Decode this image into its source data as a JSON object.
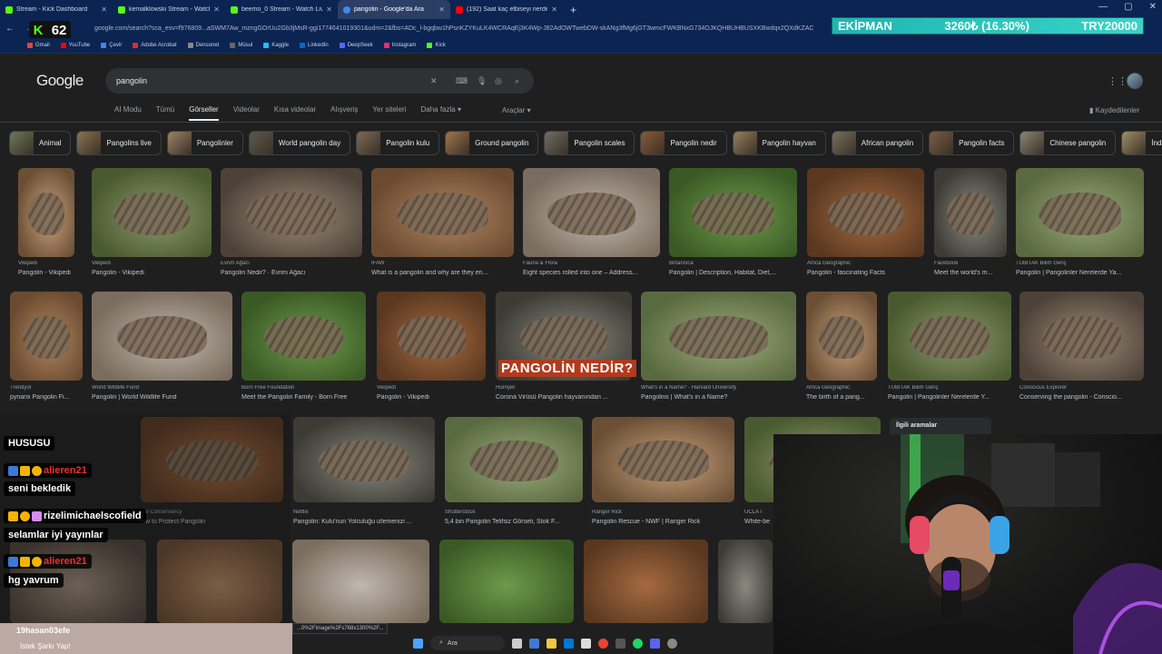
{
  "browser": {
    "tabs": [
      {
        "title": "Stream - Kick Dashboard",
        "color": "#53fc18"
      },
      {
        "title": "kemalklowski Stream - Watch Live",
        "color": "#53fc18"
      },
      {
        "title": "beemo_0 Stream - Watch Live",
        "color": "#53fc18"
      },
      {
        "title": "pangolin - Google'da Ara",
        "color": "#4285f4"
      },
      {
        "title": "(192) Saat kaç elbiseyi nerden",
        "color": "#ff0000"
      }
    ],
    "active_tab": 3,
    "url": "google.com/search?sca_esv=f976809...aSWM7Aw_mzngGOrUu2Gb3jMsR-ggi1774641019301&udm=2&fbs=ADc_l-bgqbw1hPsnKZYKuLK4WCRAqEj3K4Wp-J82AdOWTwebDW-skANg3fMg6jGT3wmcFWKBNxG734OJKQHBUHBUSXKBwdqx2QXdKZAC",
    "bookmarks": [
      "Gmail",
      "YouTube",
      "Çevir",
      "Adobe Acrobat",
      "Densonet",
      "Müsul",
      "Kaggle",
      "LinkedIn",
      "DeepSeek",
      "Instagram",
      "Kick"
    ],
    "bookmark_colors": [
      "#ea4335",
      "#ff0000",
      "#4285f4",
      "#d93025",
      "#888888",
      "#666666",
      "#20beff",
      "#0a66c2",
      "#4d6bfe",
      "#e1306c",
      "#53fc18"
    ]
  },
  "overlay": {
    "kick_count": "62",
    "ticker_label": "EKİPMAN",
    "ticker_value": "3260₺ (16.30%)",
    "ticker_goal": "TRY20000"
  },
  "google": {
    "logo": "Google",
    "query": "pangolin",
    "tabs": [
      "AI Modu",
      "Tümü",
      "Görseller",
      "Videolar",
      "Kısa videolar",
      "Alışveriş",
      "Yer siteleri",
      "Daha fazla ▾"
    ],
    "active_tab": "Görseller",
    "tools": "Araçlar ▾",
    "saved": "Kaydedilenler",
    "chips": [
      "Animal",
      "Pangolins live",
      "Pangolinler",
      "World pangolin day",
      "Pangolin kulu",
      "Ground pangolin",
      "Pangolin scales",
      "Pangolin nedir",
      "Pangolin hayvan",
      "African pangolin",
      "Pangolin facts",
      "Chinese pangolin",
      "İndian pa"
    ],
    "related": "İlgili aramalar",
    "results_row1": [
      {
        "source": "Vikipedi",
        "caption": "Pangolin - Vikipedi"
      },
      {
        "source": "Vikipedi",
        "caption": "Pangolin - Vikipedi"
      },
      {
        "source": "Evrim Ağacı",
        "caption": "Pangolin Nedir? · Evrim Ağacı"
      },
      {
        "source": "IFAW",
        "caption": "What is a pangolin and why are they en..."
      },
      {
        "source": "Fauna & Flora",
        "caption": "Eight species rolled into one – Address..."
      },
      {
        "source": "Britannica",
        "caption": "Pangolin | Description, Habitat, Diet,..."
      },
      {
        "source": "Africa Geographic",
        "caption": "Pangolin - fascinating Facts"
      },
      {
        "source": "Facebook",
        "caption": "Meet the world's m..."
      },
      {
        "source": "TÜBİTAK Bilim Genç",
        "caption": "Pangolin | Pangolinler Nerelerde Ya..."
      }
    ],
    "results_row2": [
      {
        "source": "Trendyol",
        "caption": "pynarix Pangolin Fi..."
      },
      {
        "source": "World Wildlife Fund",
        "caption": "Pangolin | World Wildlife Fund"
      },
      {
        "source": "Born Free Foundation",
        "caption": "Meet the Pangolin Family - Born Free"
      },
      {
        "source": "Vikipedi",
        "caption": "Pangolin - Vikipedi"
      },
      {
        "source": "Hürriyet",
        "caption": "Corona Virüsü Pangolin hayvanından ..."
      },
      {
        "source": "What's in a Name? - Harvard University",
        "caption": "Pangolins | What's in a Name?"
      },
      {
        "source": "Africa Geographic",
        "caption": "The birth of a pang..."
      },
      {
        "source": "TÜBİTAK Bilim Genç",
        "caption": "Pangolin | Pangolinler Nerelerde Y..."
      },
      {
        "source": "Conscious Explorer",
        "caption": "Conserving the pangolin - Conscio..."
      }
    ],
    "results_row3": [
      {
        "source": "ure Conservancy",
        "caption": "ww to Protect Pangolin"
      },
      {
        "source": "Netflix",
        "caption": "Pangolin: Kulu'nun Yolculuğu izlemenizi ..."
      },
      {
        "source": "Shutterstock",
        "caption": "5,4 bin Pangolin Telifsiz Görseli, Stok F..."
      },
      {
        "source": "Ranger Rick",
        "caption": "Pangolin Rescue - NWF | Ranger Rick"
      },
      {
        "source": "UCLA I",
        "caption": "White-be"
      }
    ],
    "image_text": "PANGOLİN NEDİR?"
  },
  "chat": {
    "messages": [
      {
        "user": "",
        "text": "HUSUSU"
      },
      {
        "user": "alieren21",
        "text": "seni bekledik"
      },
      {
        "user": "rizelimichaelscofield",
        "text": "selamlar iyi yayınlar"
      },
      {
        "user": "alieren21",
        "text": "hg yavrum"
      }
    ],
    "request_user": "19hasan03efe",
    "request_text": "İstek Şarkı Yap!"
  },
  "status_url": "...0%2Fimage%2Fs768x1300%2F...",
  "taskbar": {
    "search": "Ara"
  }
}
